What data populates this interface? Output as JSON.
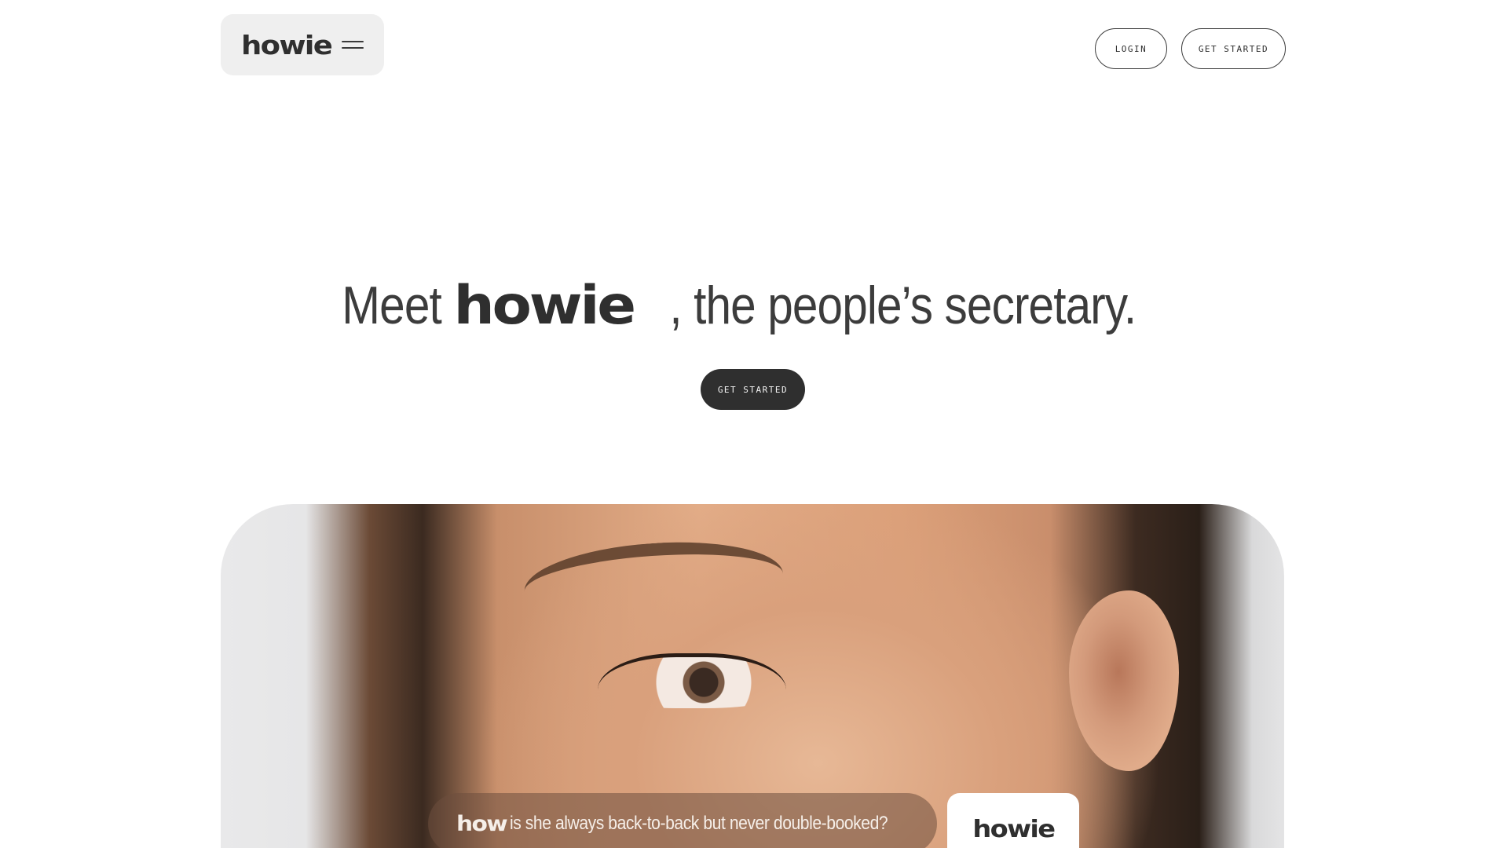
{
  "header": {
    "logo_text": "howie",
    "menu_icon": "hamburger-menu-icon",
    "login_label": "LOGIN",
    "get_started_label": "GET STARTED"
  },
  "hero": {
    "headline_prefix": "Meet",
    "headline_brand": "howie",
    "headline_suffix": ", the people’s secretary.",
    "cta_label": "GET STARTED"
  },
  "image_card": {
    "caption_brand": "how",
    "caption_text": "is she always back-to-back but never double-booked?",
    "logo_tile_text": "howie"
  },
  "colors": {
    "background": "#ffffff",
    "text": "#3c3c3c",
    "cta_dark": "#2f2f2f",
    "brand_pill": "#efefef"
  }
}
